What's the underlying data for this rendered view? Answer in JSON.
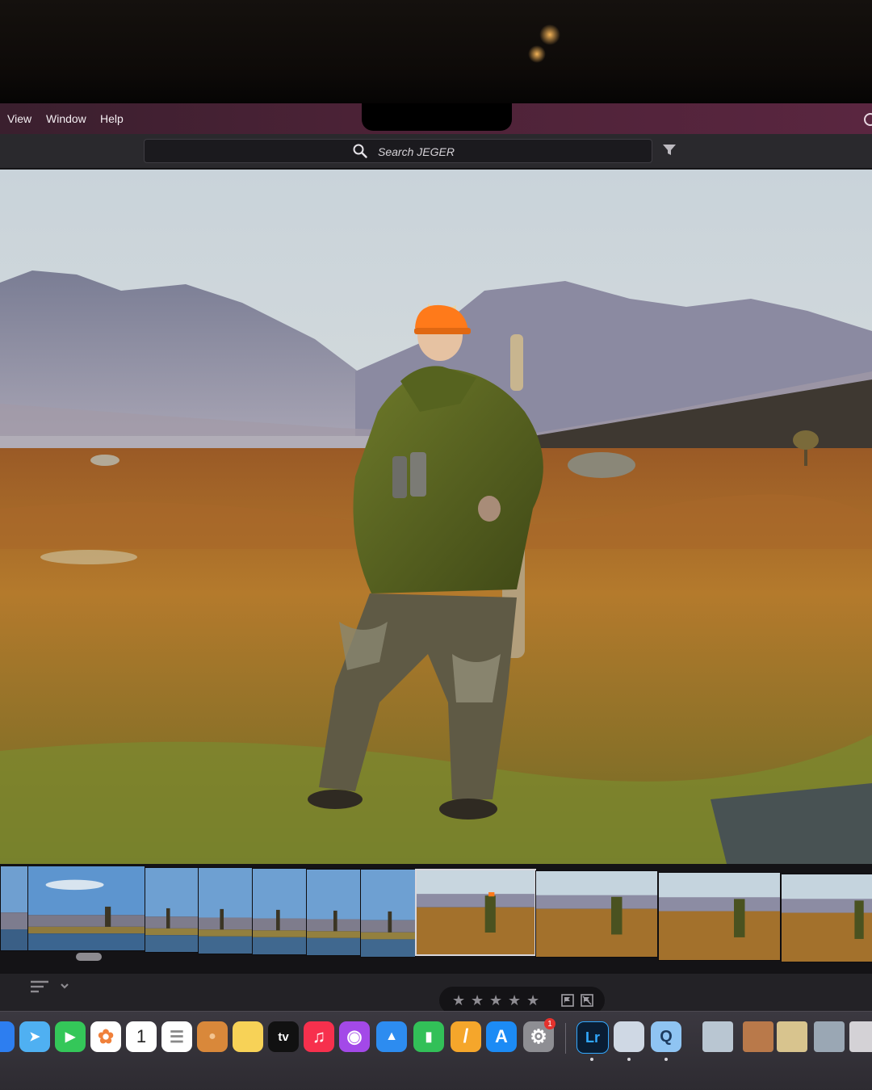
{
  "menubar": {
    "items": [
      "View",
      "Window",
      "Help"
    ]
  },
  "toolbar": {
    "search_placeholder": "Search JEGER",
    "search_icon": "magnifier-icon",
    "filter_icon": "funnel-icon"
  },
  "photo": {
    "subject": "hunter-in-orange-cap",
    "accent": "#ff7a1a"
  },
  "filmstrip": {
    "selected_index": 7,
    "thumbnail_count": 11
  },
  "rating_bar": {
    "stars": [
      "★",
      "★",
      "★",
      "★",
      "★"
    ],
    "flag_icons": [
      "pick-flag-icon",
      "reject-flag-icon"
    ]
  },
  "sort": {
    "icon": "sort-lines-icon",
    "chevron": "chevron-down-icon"
  },
  "dock": {
    "apps": [
      {
        "name": "Maps",
        "color": "#3fa3f4",
        "glyph": "➤"
      },
      {
        "name": "FaceTime",
        "color": "#34c759",
        "glyph": "▶"
      },
      {
        "name": "Photos",
        "color": "#ffffff",
        "glyph": "✿"
      },
      {
        "name": "Calendar",
        "color": "#ffffff",
        "glyph": "1"
      },
      {
        "name": "Reminders",
        "color": "#ffffff",
        "glyph": "☰"
      },
      {
        "name": "Contacts",
        "color": "#d9883a",
        "glyph": "●"
      },
      {
        "name": "Notes",
        "color": "#f7d257",
        "glyph": ""
      },
      {
        "name": "TV",
        "color": "#111111",
        "glyph": "tv"
      },
      {
        "name": "Music",
        "color": "#f7304d",
        "glyph": "♫"
      },
      {
        "name": "Podcasts",
        "color": "#a349e8",
        "glyph": "◉"
      },
      {
        "name": "Keynote",
        "color": "#2d8cf0",
        "glyph": "▲"
      },
      {
        "name": "Numbers",
        "color": "#32c058",
        "glyph": "▮"
      },
      {
        "name": "Pages",
        "color": "#f5a62b",
        "glyph": "/"
      },
      {
        "name": "App Store",
        "color": "#1c8bf5",
        "glyph": "A"
      },
      {
        "name": "System Settings",
        "color": "#8e8e93",
        "glyph": "⚙"
      },
      {
        "name": "Lightroom",
        "color": "#0a1d33",
        "glyph": "Lr"
      },
      {
        "name": "Preview",
        "color": "#cfd8e4",
        "glyph": ""
      },
      {
        "name": "QuickTime",
        "color": "#8fc4f2",
        "glyph": "Q"
      }
    ],
    "settings_badge": "1"
  }
}
